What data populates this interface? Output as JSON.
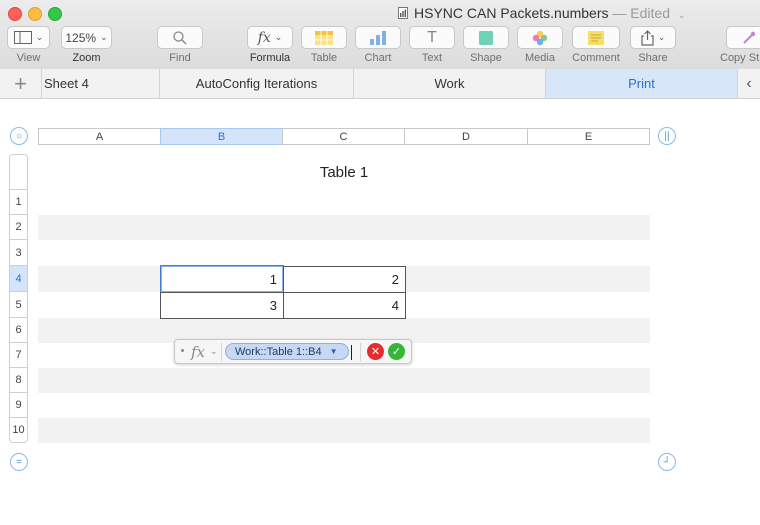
{
  "window": {
    "title": "HSYNC CAN Packets.numbers",
    "status": "— Edited"
  },
  "toolbar": {
    "view": {
      "label": "View",
      "icon": "sidebar-view-icon"
    },
    "zoom": {
      "label": "Zoom",
      "value": "125%"
    },
    "find": {
      "label": "Find",
      "icon": "search-icon"
    },
    "formula": {
      "label": "Formula",
      "icon_text": "fx"
    },
    "table": {
      "label": "Table",
      "icon": "table-icon"
    },
    "chart": {
      "label": "Chart",
      "icon": "chart-icon"
    },
    "text": {
      "label": "Text",
      "icon_text": "T"
    },
    "shape": {
      "label": "Shape",
      "icon": "shape-icon"
    },
    "media": {
      "label": "Media",
      "icon": "media-icon"
    },
    "comment": {
      "label": "Comment",
      "icon": "comment-icon"
    },
    "share": {
      "label": "Share",
      "icon": "share-icon"
    },
    "copy_style": {
      "label": "Copy St",
      "icon": "eyedropper-icon"
    }
  },
  "tabs": {
    "items": [
      {
        "label": "Sheet 4"
      },
      {
        "label": "AutoConfig Iterations"
      },
      {
        "label": "Work"
      },
      {
        "label": "Print"
      }
    ],
    "active": "Print"
  },
  "columns": [
    "A",
    "B",
    "C",
    "D",
    "E"
  ],
  "selected_column": "B",
  "rows": [
    "1",
    "2",
    "3",
    "4",
    "5",
    "6",
    "7",
    "8",
    "9",
    "10"
  ],
  "selected_row": "4",
  "table": {
    "title": "Table 1",
    "cells": [
      [
        "1",
        "2"
      ],
      [
        "3",
        "4"
      ]
    ]
  },
  "formula_editor": {
    "fx": "fx",
    "reference": "Work::Table 1::B4",
    "cancel_glyph": "✕",
    "accept_glyph": "✓"
  },
  "colors": {
    "accent": "#2a6fd6",
    "selection": "#d4e5fb",
    "cancel": "#e62d2d",
    "accept": "#35b635"
  }
}
